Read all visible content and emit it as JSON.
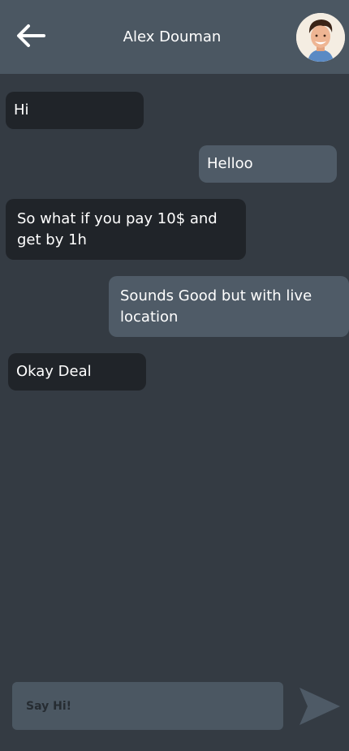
{
  "header": {
    "title": "Alex Douman",
    "back_icon": "arrow-left-icon",
    "avatar_icon": "avatar"
  },
  "messages": [
    {
      "side": "received",
      "text": "Hi"
    },
    {
      "side": "sent",
      "text": "Helloo"
    },
    {
      "side": "received",
      "text": "So what if you pay 10$ and get by 1h"
    },
    {
      "side": "sent",
      "text": "Sounds Good but with live location"
    },
    {
      "side": "received",
      "text": "Okay Deal"
    }
  ],
  "composer": {
    "placeholder": "Say Hi!",
    "value": "",
    "send_icon": "send-icon"
  },
  "colors": {
    "background": "#343b43",
    "header": "#4b5762",
    "received_bubble": "#202429",
    "sent_bubble": "#4f5b67"
  }
}
